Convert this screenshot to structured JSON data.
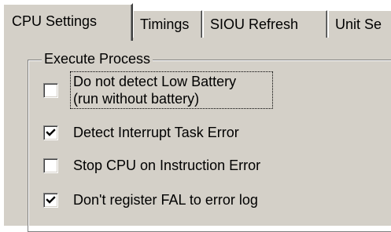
{
  "tabs": [
    {
      "label": "CPU Settings",
      "active": true
    },
    {
      "label": "Timings",
      "active": false
    },
    {
      "label": "SIOU Refresh",
      "active": false
    },
    {
      "label": "Unit Se",
      "active": false
    }
  ],
  "group": {
    "title": "Execute Process",
    "options": [
      {
        "label_line1": "Do not detect Low Battery",
        "label_line2": "(run without battery)",
        "checked": false,
        "focused": true
      },
      {
        "label": "Detect Interrupt Task Error",
        "checked": true
      },
      {
        "label": "Stop CPU on Instruction Error",
        "checked": false
      },
      {
        "label": "Don't register FAL to error log",
        "checked": true
      }
    ]
  },
  "colors": {
    "face": "#d4d0c8",
    "highlight": "#ffffff",
    "shadow": "#808080",
    "dark_shadow": "#404040"
  },
  "icons": {
    "check": "checkmark-icon"
  }
}
